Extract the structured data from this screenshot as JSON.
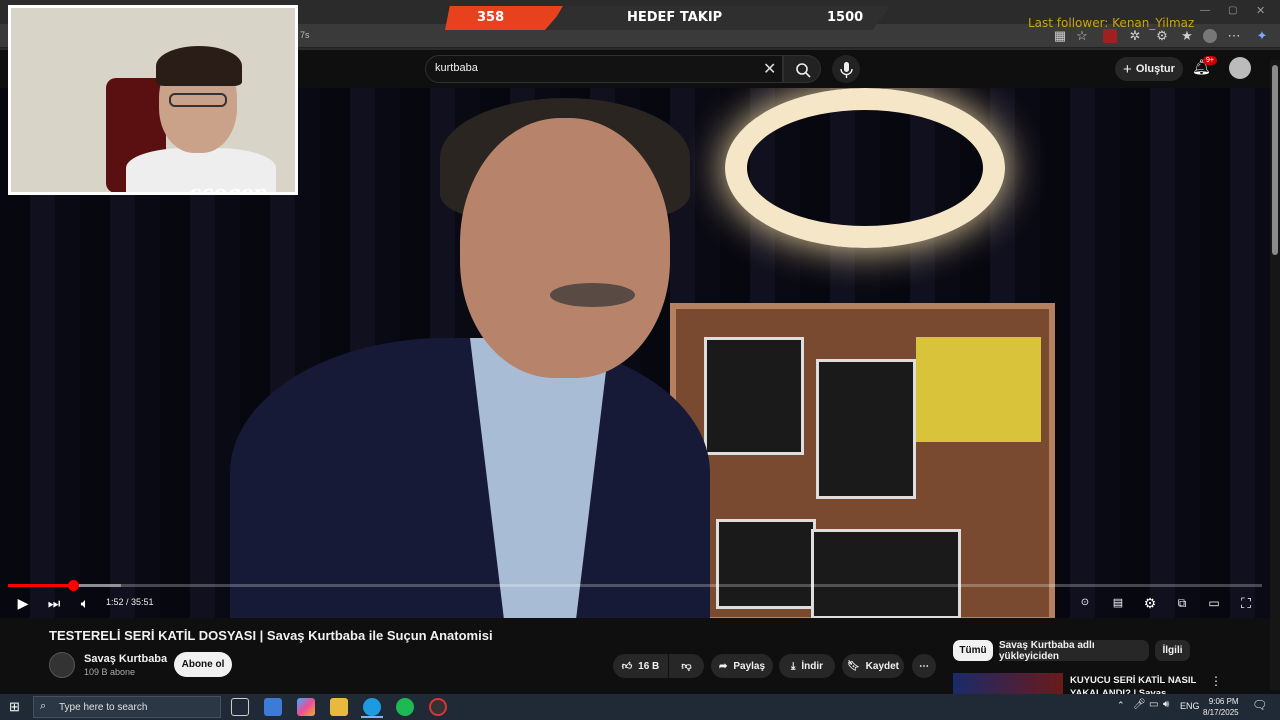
{
  "stream_overlay": {
    "left_count": "358",
    "label": "HEDEF TAKIP",
    "right_count": "1500",
    "last_follower": "Last follower: Kenan_Yilmaz"
  },
  "browser": {
    "address_fragment": "7s"
  },
  "header": {
    "search_value": "kurtbaba",
    "create_label": "Oluştur",
    "notif_badge": "9+"
  },
  "webcam": {
    "label": "ccogen"
  },
  "player": {
    "timecode": "1:52 / 35:51",
    "progress_fraction": 0.052,
    "buffer_fraction": 0.09
  },
  "video": {
    "title": "TESTERELİ SERİ KATİL DOSYASI | Savaş Kurtbaba ile Suçun Anatomisi",
    "channel_name": "Savaş Kurtbaba",
    "subscribers": "109 B abone",
    "subscribe_label": "Abone ol",
    "likes": "16 B",
    "share_label": "Paylaş",
    "download_label": "İndir",
    "save_label": "Kaydet"
  },
  "chips": [
    "Tümü",
    "Savaş Kurtbaba adlı yükleyiciden",
    "İlgili"
  ],
  "recommendation": {
    "title": "KUYUCU SERİ KATİL NASIL YAKALANDI? | Savaş Kurtbaba"
  },
  "taskbar": {
    "search_placeholder": "Type here to search",
    "lang": "ENG",
    "time": "9:06 PM",
    "date": "8/17/2025"
  },
  "colors": {
    "accent_red": "#ff0000",
    "overlay_orange": "#e8411e",
    "follower_yellow": "#e8b800"
  }
}
